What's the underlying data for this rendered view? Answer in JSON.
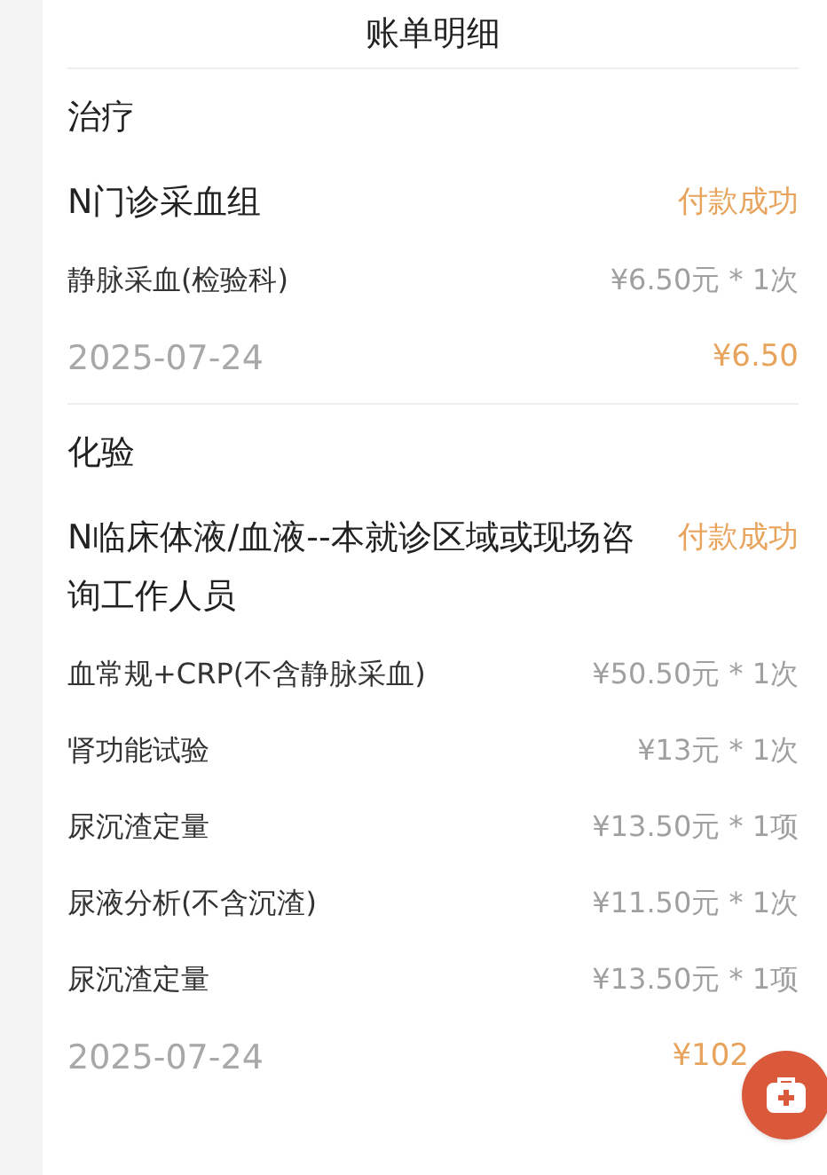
{
  "title": "账单明细",
  "sections": [
    {
      "name": "治疗",
      "groups": [
        {
          "name": "N门诊采血组",
          "status": "付款成功",
          "items": [
            {
              "name": "静脉采血(检验科)",
              "price": "¥6.50元 * 1次"
            }
          ],
          "date": "2025-07-24",
          "total": "¥6.50"
        }
      ]
    },
    {
      "name": "化验",
      "groups": [
        {
          "name": "N临床体液/血液--本就诊区域或现场咨询工作人员",
          "status": "付款成功",
          "items": [
            {
              "name": "血常规+CRP(不含静脉采血)",
              "price": "¥50.50元 * 1次"
            },
            {
              "name": "肾功能试验",
              "price": "¥13元 * 1次"
            },
            {
              "name": "尿沉渣定量",
              "price": "¥13.50元 * 1项"
            },
            {
              "name": "尿液分析(不含沉渣)",
              "price": "¥11.50元 * 1次"
            },
            {
              "name": "尿沉渣定量",
              "price": "¥13.50元 * 1项"
            }
          ],
          "date": "2025-07-24",
          "total": "¥102"
        }
      ]
    }
  ]
}
